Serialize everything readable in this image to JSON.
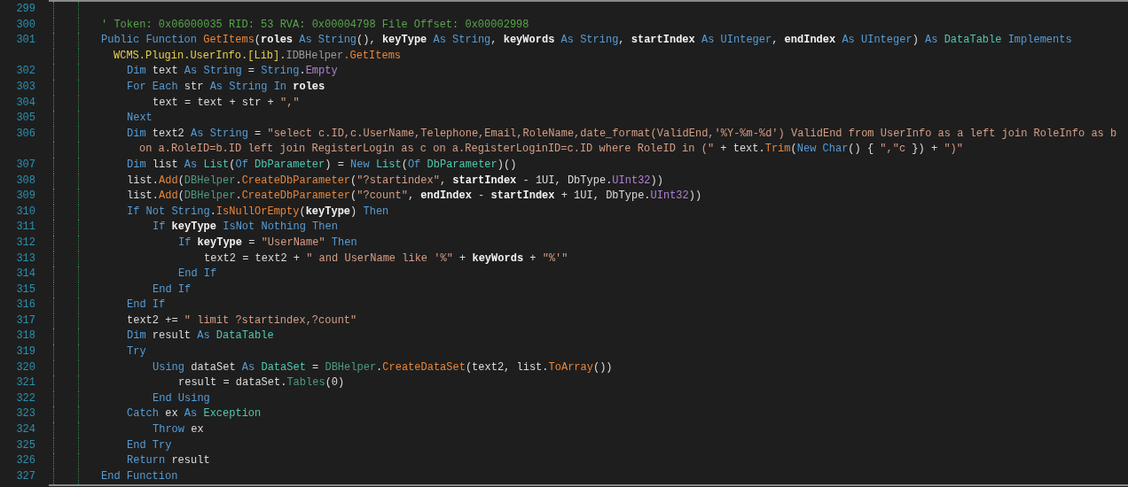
{
  "editor": {
    "lines": [
      {
        "number": "299"
      },
      {
        "number": "300",
        "tokens": [
          {
            "kind": "comment",
            "text": "' Token: 0x06000035 RID: 53 RVA: 0x00004798 File Offset: 0x00002998"
          }
        ]
      },
      {
        "number": "301",
        "tokens": [
          {
            "kind": "keyword",
            "text": "Public Function "
          },
          {
            "kind": "function",
            "text": "GetItems"
          },
          {
            "kind": "plain",
            "text": "("
          },
          {
            "kind": "param",
            "text": "roles"
          },
          {
            "kind": "keyword",
            "text": " As String"
          },
          {
            "kind": "plain",
            "text": "(), "
          },
          {
            "kind": "param",
            "text": "keyType"
          },
          {
            "kind": "keyword",
            "text": " As String"
          },
          {
            "kind": "plain",
            "text": ", "
          },
          {
            "kind": "param",
            "text": "keyWords"
          },
          {
            "kind": "keyword",
            "text": " As String"
          },
          {
            "kind": "plain",
            "text": ", "
          },
          {
            "kind": "param",
            "text": "startIndex"
          },
          {
            "kind": "keyword",
            "text": " As UInteger"
          },
          {
            "kind": "plain",
            "text": ", "
          },
          {
            "kind": "param",
            "text": "endIndex"
          },
          {
            "kind": "keyword",
            "text": " As UInteger"
          },
          {
            "kind": "plain",
            "text": ") "
          },
          {
            "kind": "keyword",
            "text": "As "
          },
          {
            "kind": "type",
            "text": "DataTable"
          },
          {
            "kind": "keyword",
            "text": " Implements"
          }
        ],
        "wrap": [
          {
            "kind": "namespace",
            "text": "WCMS.Plugin.UserInfo.[Lib]."
          },
          {
            "kind": "interface",
            "text": "IDBHelper."
          },
          {
            "kind": "function",
            "text": "GetItems"
          }
        ],
        "children": [
          {
            "number": "302",
            "tokens": [
              {
                "kind": "keyword",
                "text": "Dim"
              },
              {
                "kind": "plain",
                "text": " text "
              },
              {
                "kind": "keyword",
                "text": "As String"
              },
              {
                "kind": "plain",
                "text": " = "
              },
              {
                "kind": "keyword",
                "text": "String"
              },
              {
                "kind": "plain",
                "text": "."
              },
              {
                "kind": "enum",
                "text": "Empty"
              }
            ]
          },
          {
            "number": "303",
            "tokens": [
              {
                "kind": "keyword",
                "text": "For Each"
              },
              {
                "kind": "plain",
                "text": " str "
              },
              {
                "kind": "keyword",
                "text": "As String In "
              },
              {
                "kind": "param",
                "text": "roles"
              }
            ],
            "children": [
              {
                "number": "304",
                "tokens": [
                  {
                    "kind": "plain",
                    "text": "text = text + str + "
                  },
                  {
                    "kind": "string",
                    "text": "\",\""
                  }
                ]
              }
            ]
          },
          {
            "number": "305",
            "tokens": [
              {
                "kind": "keyword",
                "text": "Next"
              }
            ]
          },
          {
            "number": "306",
            "tokens": [
              {
                "kind": "keyword",
                "text": "Dim"
              },
              {
                "kind": "plain",
                "text": " text2 "
              },
              {
                "kind": "keyword",
                "text": "As String"
              },
              {
                "kind": "plain",
                "text": " = "
              },
              {
                "kind": "string",
                "text": "\"select c.ID,c.UserName,Telephone,Email,RoleName,date_format(ValidEnd,'%Y-%m-%d') ValidEnd from UserInfo as a left join RoleInfo as b"
              }
            ],
            "wrap": [
              {
                "kind": "string",
                "text": "on a.RoleID=b.ID left join RegisterLogin as c on a.RegisterLoginID=c.ID where RoleID in (\""
              },
              {
                "kind": "plain",
                "text": " + text."
              },
              {
                "kind": "function",
                "text": "Trim"
              },
              {
                "kind": "plain",
                "text": "("
              },
              {
                "kind": "keyword",
                "text": "New Char"
              },
              {
                "kind": "plain",
                "text": "() { "
              },
              {
                "kind": "string",
                "text": "\",\"c"
              },
              {
                "kind": "plain",
                "text": " }) + "
              },
              {
                "kind": "string",
                "text": "\")\""
              }
            ]
          },
          {
            "number": "307",
            "tokens": [
              {
                "kind": "keyword",
                "text": "Dim"
              },
              {
                "kind": "plain",
                "text": " list "
              },
              {
                "kind": "keyword",
                "text": "As "
              },
              {
                "kind": "type",
                "text": "List"
              },
              {
                "kind": "plain",
                "text": "("
              },
              {
                "kind": "keyword",
                "text": "Of "
              },
              {
                "kind": "type",
                "text": "DbParameter"
              },
              {
                "kind": "plain",
                "text": ") = "
              },
              {
                "kind": "keyword",
                "text": "New "
              },
              {
                "kind": "type",
                "text": "List"
              },
              {
                "kind": "plain",
                "text": "("
              },
              {
                "kind": "keyword",
                "text": "Of "
              },
              {
                "kind": "type",
                "text": "DbParameter"
              },
              {
                "kind": "plain",
                "text": ")()"
              }
            ]
          },
          {
            "number": "308",
            "tokens": [
              {
                "kind": "plain",
                "text": "list."
              },
              {
                "kind": "function",
                "text": "Add"
              },
              {
                "kind": "plain",
                "text": "("
              },
              {
                "kind": "helper",
                "text": "DBHelper"
              },
              {
                "kind": "plain",
                "text": "."
              },
              {
                "kind": "function",
                "text": "CreateDbParameter"
              },
              {
                "kind": "plain",
                "text": "("
              },
              {
                "kind": "string",
                "text": "\"?startindex\""
              },
              {
                "kind": "plain",
                "text": ", "
              },
              {
                "kind": "param",
                "text": "startIndex"
              },
              {
                "kind": "plain",
                "text": " - 1UI, DbType."
              },
              {
                "kind": "enum",
                "text": "UInt32"
              },
              {
                "kind": "plain",
                "text": "))"
              }
            ]
          },
          {
            "number": "309",
            "tokens": [
              {
                "kind": "plain",
                "text": "list."
              },
              {
                "kind": "function",
                "text": "Add"
              },
              {
                "kind": "plain",
                "text": "("
              },
              {
                "kind": "helper",
                "text": "DBHelper"
              },
              {
                "kind": "plain",
                "text": "."
              },
              {
                "kind": "function",
                "text": "CreateDbParameter"
              },
              {
                "kind": "plain",
                "text": "("
              },
              {
                "kind": "string",
                "text": "\"?count\""
              },
              {
                "kind": "plain",
                "text": ", "
              },
              {
                "kind": "param",
                "text": "endIndex"
              },
              {
                "kind": "plain",
                "text": " - "
              },
              {
                "kind": "param",
                "text": "startIndex"
              },
              {
                "kind": "plain",
                "text": " + 1UI, DbType."
              },
              {
                "kind": "enum",
                "text": "UInt32"
              },
              {
                "kind": "plain",
                "text": "))"
              }
            ]
          },
          {
            "number": "310",
            "tokens": [
              {
                "kind": "keyword",
                "text": "If Not String"
              },
              {
                "kind": "plain",
                "text": "."
              },
              {
                "kind": "function",
                "text": "IsNullOrEmpty"
              },
              {
                "kind": "plain",
                "text": "("
              },
              {
                "kind": "param",
                "text": "keyType"
              },
              {
                "kind": "plain",
                "text": ") "
              },
              {
                "kind": "keyword",
                "text": "Then"
              }
            ],
            "children": [
              {
                "number": "311",
                "tokens": [
                  {
                    "kind": "keyword",
                    "text": "If "
                  },
                  {
                    "kind": "param",
                    "text": "keyType"
                  },
                  {
                    "kind": "keyword",
                    "text": " IsNot Nothing Then"
                  }
                ],
                "children": [
                  {
                    "number": "312",
                    "tokens": [
                      {
                        "kind": "keyword",
                        "text": "If "
                      },
                      {
                        "kind": "param",
                        "text": "keyType"
                      },
                      {
                        "kind": "plain",
                        "text": " = "
                      },
                      {
                        "kind": "string",
                        "text": "\"UserName\""
                      },
                      {
                        "kind": "keyword",
                        "text": " Then"
                      }
                    ],
                    "children": [
                      {
                        "number": "313",
                        "tokens": [
                          {
                            "kind": "plain",
                            "text": "text2 = text2 + "
                          },
                          {
                            "kind": "string",
                            "text": "\" and UserName like '%\""
                          },
                          {
                            "kind": "plain",
                            "text": " + "
                          },
                          {
                            "kind": "param",
                            "text": "keyWords"
                          },
                          {
                            "kind": "plain",
                            "text": " + "
                          },
                          {
                            "kind": "string",
                            "text": "\"%'\""
                          }
                        ]
                      }
                    ]
                  },
                  {
                    "number": "314",
                    "tokens": [
                      {
                        "kind": "keyword",
                        "text": "End If"
                      }
                    ]
                  }
                ]
              },
              {
                "number": "315",
                "tokens": [
                  {
                    "kind": "keyword",
                    "text": "End If"
                  }
                ]
              }
            ]
          },
          {
            "number": "316",
            "tokens": [
              {
                "kind": "keyword",
                "text": "End If"
              }
            ]
          },
          {
            "number": "317",
            "tokens": [
              {
                "kind": "plain",
                "text": "text2 += "
              },
              {
                "kind": "string",
                "text": "\" limit ?startindex,?count\""
              }
            ]
          },
          {
            "number": "318",
            "tokens": [
              {
                "kind": "keyword",
                "text": "Dim"
              },
              {
                "kind": "plain",
                "text": " result "
              },
              {
                "kind": "keyword",
                "text": "As "
              },
              {
                "kind": "type",
                "text": "DataTable"
              }
            ]
          },
          {
            "number": "319",
            "tokens": [
              {
                "kind": "keyword",
                "text": "Try"
              }
            ],
            "children": [
              {
                "number": "320",
                "tokens": [
                  {
                    "kind": "keyword",
                    "text": "Using"
                  },
                  {
                    "kind": "plain",
                    "text": " dataSet "
                  },
                  {
                    "kind": "keyword",
                    "text": "As "
                  },
                  {
                    "kind": "type",
                    "text": "DataSet"
                  },
                  {
                    "kind": "plain",
                    "text": " = "
                  },
                  {
                    "kind": "helper",
                    "text": "DBHelper"
                  },
                  {
                    "kind": "plain",
                    "text": "."
                  },
                  {
                    "kind": "function",
                    "text": "CreateDataSet"
                  },
                  {
                    "kind": "plain",
                    "text": "(text2, list."
                  },
                  {
                    "kind": "function",
                    "text": "ToArray"
                  },
                  {
                    "kind": "plain",
                    "text": "())"
                  }
                ],
                "children": [
                  {
                    "number": "321",
                    "tokens": [
                      {
                        "kind": "plain",
                        "text": "result = dataSet."
                      },
                      {
                        "kind": "helper",
                        "text": "Tables"
                      },
                      {
                        "kind": "plain",
                        "text": "(0)"
                      }
                    ]
                  }
                ]
              },
              {
                "number": "322",
                "tokens": [
                  {
                    "kind": "keyword",
                    "text": "End Using"
                  }
                ]
              }
            ]
          },
          {
            "number": "323",
            "tokens": [
              {
                "kind": "keyword",
                "text": "Catch"
              },
              {
                "kind": "plain",
                "text": " ex "
              },
              {
                "kind": "keyword",
                "text": "As "
              },
              {
                "kind": "type",
                "text": "Exception"
              }
            ],
            "children": [
              {
                "number": "324",
                "tokens": [
                  {
                    "kind": "keyword",
                    "text": "Throw"
                  },
                  {
                    "kind": "plain",
                    "text": " ex"
                  }
                ]
              }
            ]
          },
          {
            "number": "325",
            "tokens": [
              {
                "kind": "keyword",
                "text": "End Try"
              }
            ]
          },
          {
            "number": "326",
            "tokens": [
              {
                "kind": "keyword",
                "text": "Return"
              },
              {
                "kind": "plain",
                "text": " result"
              }
            ]
          }
        ]
      },
      {
        "number": "327",
        "tokens": [
          {
            "kind": "keyword",
            "text": "End Function"
          }
        ]
      }
    ]
  }
}
